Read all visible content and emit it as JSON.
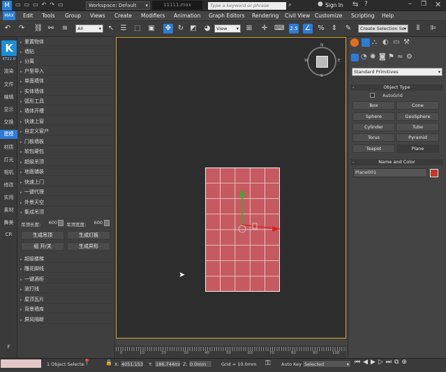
{
  "titlebar": {
    "workspace": "Workspace: Default",
    "filename": "11111.max",
    "search_placeholder": "Type a keyword or phrase",
    "sign_in": "Sign In"
  },
  "menu": [
    "Edit",
    "Tools",
    "Group",
    "Views",
    "Create",
    "Modifiers",
    "Animation",
    "Graph Editors",
    "Rendering",
    "Civil View",
    "Customize",
    "Scripting",
    "Help"
  ],
  "toolbar": {
    "selection_filter": "All",
    "ref_coord": "View",
    "named_selection": "Create Selection Se"
  },
  "left_tabs": {
    "logo": "K",
    "version": "KT22.0",
    "items": [
      "渲染",
      "文件",
      "编辑",
      "显示",
      "交换",
      "建模",
      "材质",
      "灯光",
      "相机",
      "修改",
      "实用",
      "素材",
      "舞美",
      "CR"
    ],
    "bottom": "F"
  },
  "plugin_panel": {
    "items_top": [
      "重置物体",
      "墙贴",
      "分离",
      "户型导入",
      "单面墙体",
      "实体墙体",
      "弧形工具",
      "墙体开槽",
      "快速上窗",
      "自定义窗户",
      "门板墙板",
      "软包硬包",
      "超级吊顶",
      "地面铺装",
      "快速上门",
      "一键代理",
      "外景天空"
    ],
    "section": "集成吊顶",
    "length_label": "吊顶长度:",
    "length_value": "600",
    "width_label": "吊顶宽度:",
    "width_value": "600",
    "buttons": [
      "生成吊顶",
      "生成灯板",
      "组 开/关",
      "生成异形"
    ],
    "items_bottom": [
      "超级楼梯",
      "雕花脚线",
      "一键酒柜",
      "波打线",
      "屋顶瓦片",
      "背景墙库",
      "屏风隔断"
    ]
  },
  "viewport": {
    "compass": [
      "N",
      "E",
      "S",
      "W"
    ],
    "ruler_ticks": [
      "0",
      "10",
      "20",
      "30",
      "40",
      "50",
      "60",
      "70",
      "80",
      "90",
      "100"
    ]
  },
  "command_panel": {
    "category": "Standard Primitives",
    "object_type_title": "Object Type",
    "autogrid": "AutoGrid",
    "objects": [
      "Box",
      "Cone",
      "Sphere",
      "GeoSphere",
      "Cylinder",
      "Tube",
      "Torus",
      "Pyramid",
      "Teapot",
      "Plane"
    ],
    "name_color_title": "Name and Color",
    "object_name": "Plane001",
    "object_color": "#c0392b"
  },
  "status": {
    "selection": "1 Object Selecte",
    "x_label": "X:",
    "x_value": "4051.153n",
    "y_label": "Y:",
    "y_value": "186.744mr",
    "z_label": "Z:",
    "z_value": "0.0mm",
    "grid": "Grid = 10.0mm",
    "auto_key": "Auto Key",
    "key_filter": "Selected"
  }
}
